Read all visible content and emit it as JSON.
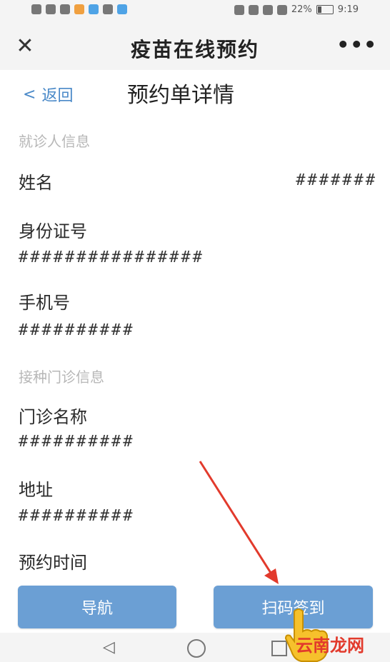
{
  "status_bar": {
    "battery": "22%",
    "time": "9:19"
  },
  "title_bar": {
    "close_label": "✕",
    "title": "疫苗在线预约",
    "more_label": "•••"
  },
  "header": {
    "back_label": "返回",
    "page_title": "预约单详情"
  },
  "patient_section": {
    "label": "就诊人信息",
    "name_label": "姓名",
    "name_value": "#######",
    "id_label": "身份证号",
    "id_value": "################",
    "phone_label": "手机号",
    "phone_value": "##########"
  },
  "clinic_section": {
    "label": "接种门诊信息",
    "clinic_label": "门诊名称",
    "clinic_value": "##########",
    "address_label": "地址",
    "address_value": "##########",
    "time_label": "预约时间"
  },
  "actions": {
    "navigate_label": "导航",
    "scan_label": "扫码签到"
  },
  "watermark": {
    "text": "云南龙网"
  },
  "colors": {
    "button_bg": "#6b9fd4",
    "link": "#4a89c8",
    "annotation_arrow": "#e23a2c"
  }
}
